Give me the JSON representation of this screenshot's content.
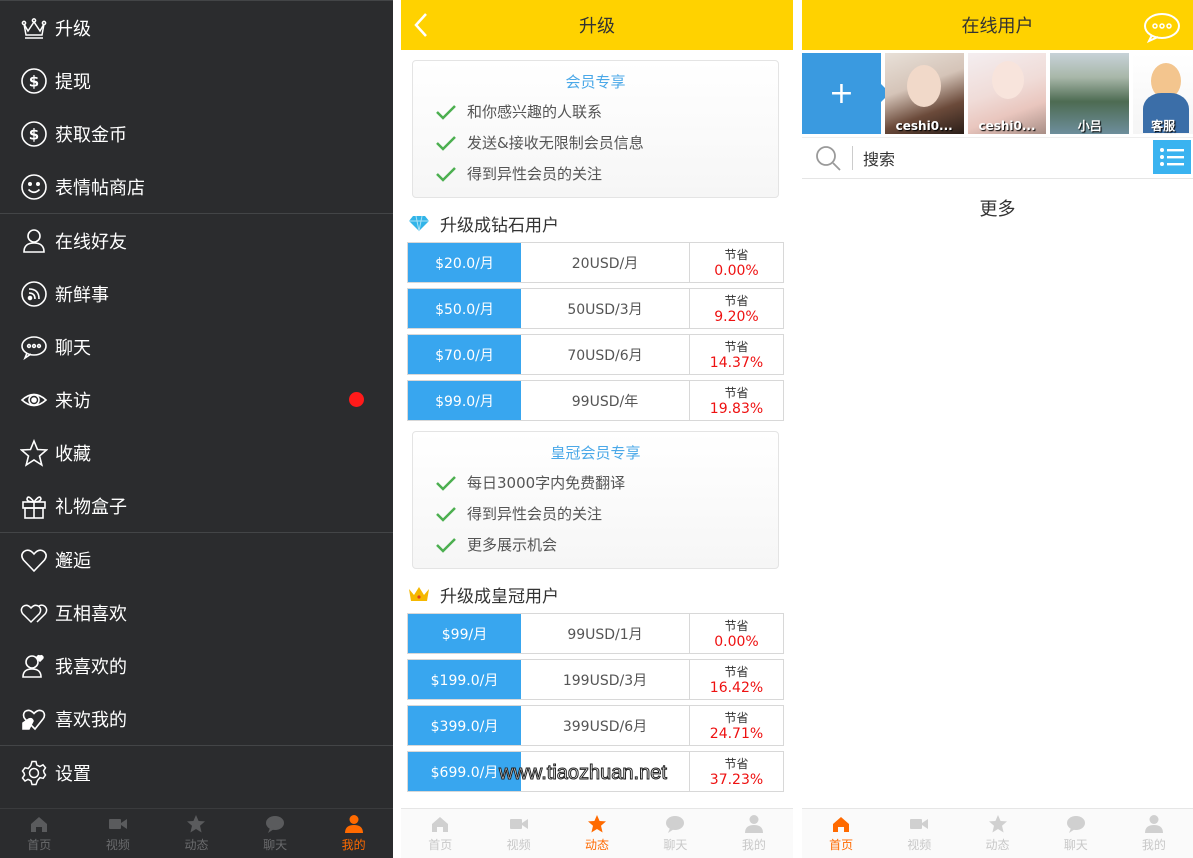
{
  "menu": {
    "items": [
      {
        "label": "升级",
        "icon": "crown-icon"
      },
      {
        "label": "提现",
        "icon": "dollar-icon"
      },
      {
        "label": "获取金币",
        "icon": "dollar-icon"
      },
      {
        "label": "表情帖商店",
        "icon": "smiley-icon"
      },
      {
        "label": "在线好友",
        "icon": "person-icon"
      },
      {
        "label": "新鲜事",
        "icon": "rss-icon"
      },
      {
        "label": "聊天",
        "icon": "chat-bubble-icon"
      },
      {
        "label": "来访",
        "icon": "eye-icon"
      },
      {
        "label": "收藏",
        "icon": "star-icon"
      },
      {
        "label": "礼物盒子",
        "icon": "gift-icon"
      },
      {
        "label": "邂逅",
        "icon": "heart-icon"
      },
      {
        "label": "互相喜欢",
        "icon": "double-heart-icon"
      },
      {
        "label": "我喜欢的",
        "icon": "person-heart-icon"
      },
      {
        "label": "喜欢我的",
        "icon": "hand-heart-icon"
      },
      {
        "label": "设置",
        "icon": "gear-icon"
      }
    ]
  },
  "tabs": [
    "首页",
    "视频",
    "动态",
    "聊天",
    "我的"
  ],
  "upgrade": {
    "title": "升级",
    "member_box": {
      "title": "会员专享",
      "perks": [
        "和你感兴趣的人联系",
        "发送&接收无限制会员信息",
        "得到异性会员的关注"
      ]
    },
    "diamond_title": "升级成钻石用户",
    "diamond_plans": [
      {
        "price": "$20.0/月",
        "duration": "20USD/月",
        "save_label": "节省",
        "save": "0.00%"
      },
      {
        "price": "$50.0/月",
        "duration": "50USD/3月",
        "save_label": "节省",
        "save": "9.20%"
      },
      {
        "price": "$70.0/月",
        "duration": "70USD/6月",
        "save_label": "节省",
        "save": "14.37%"
      },
      {
        "price": "$99.0/月",
        "duration": "99USD/年",
        "save_label": "节省",
        "save": "19.83%"
      }
    ],
    "crown_box": {
      "title": "皇冠会员专享",
      "perks": [
        "每日3000字内免费翻译",
        "得到异性会员的关注",
        "更多展示机会"
      ]
    },
    "crown_title": "升级成皇冠用户",
    "crown_plans": [
      {
        "price": "$99/月",
        "duration": "99USD/1月",
        "save_label": "节省",
        "save": "0.00%"
      },
      {
        "price": "$199.0/月",
        "duration": "199USD/3月",
        "save_label": "节省",
        "save": "16.42%"
      },
      {
        "price": "$399.0/月",
        "duration": "399USD/6月",
        "save_label": "节省",
        "save": "24.71%"
      },
      {
        "price": "$699.0/月",
        "duration": "",
        "save_label": "节省",
        "save": "37.23%"
      }
    ],
    "watermark": "www.tiaozhuan.net"
  },
  "online": {
    "title": "在线用户",
    "add_label": "+",
    "users": [
      {
        "name": "ceshi0..."
      },
      {
        "name": "ceshi0..."
      },
      {
        "name": "小吕"
      },
      {
        "name": "客服"
      }
    ],
    "search_placeholder": "搜索",
    "more_label": "更多"
  },
  "colors": {
    "header_yellow": "#ffd200",
    "price_blue": "#38a6ef",
    "save_red": "#ee1111",
    "active_tab": "#ff6a00",
    "menu_bg": "#2b2c2e"
  }
}
